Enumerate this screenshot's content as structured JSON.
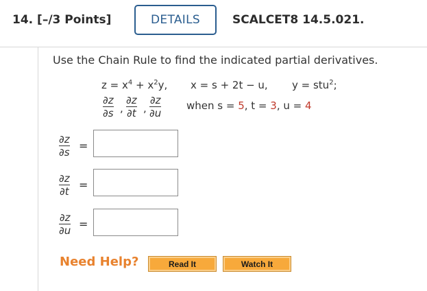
{
  "header": {
    "question_number": "14.",
    "points": "[–/3 Points]",
    "details_label": "DETAILS",
    "course_code": "SCALCET8 14.5.021."
  },
  "problem": {
    "instruction": "Use the Chain Rule to find the indicated partial derivatives.",
    "given": {
      "z": "z = x",
      "z_exp1": "4",
      "z_mid": " + x",
      "z_exp2": "2",
      "z_end": "y,",
      "x": "x = s + 2t − u,",
      "y": "y = stu",
      "y_exp": "2",
      "y_end": ";"
    },
    "derivatives": [
      {
        "num": "∂z",
        "den": "∂s"
      },
      {
        "num": "∂z",
        "den": "∂t"
      },
      {
        "num": "∂z",
        "den": "∂u"
      }
    ],
    "when": {
      "prefix": "when s = ",
      "s_val": "5",
      "sep1": ", t = ",
      "t_val": "3",
      "sep2": ", u = ",
      "u_val": "4"
    }
  },
  "answers": [
    {
      "num": "∂z",
      "den": "∂s",
      "eq": "=",
      "value": ""
    },
    {
      "num": "∂z",
      "den": "∂t",
      "eq": "=",
      "value": ""
    },
    {
      "num": "∂z",
      "den": "∂u",
      "eq": "=",
      "value": ""
    }
  ],
  "help": {
    "label": "Need Help?",
    "read_it": "Read It",
    "watch_it": "Watch It"
  },
  "colors": {
    "accent_blue": "#2a5d8f",
    "highlight_red": "#c0392b",
    "need_help_orange": "#e8822e",
    "button_orange": "#f7a93b"
  }
}
